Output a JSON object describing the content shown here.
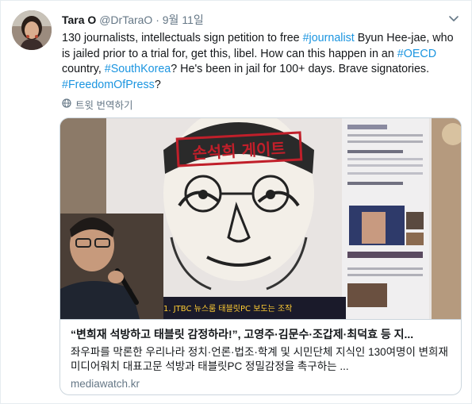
{
  "tweet": {
    "author_name": "Tara O",
    "handle": "@DrTaraO",
    "separator": "·",
    "date": "9월 11일",
    "text_segments": [
      {
        "text": "130 journalists, intellectuals sign petition to free ",
        "type": "text"
      },
      {
        "text": "#journalist",
        "type": "hashtag"
      },
      {
        "text": " Byun Hee-jae, who is jailed prior to a trial for, get this, libel. How can this happen in an ",
        "type": "text"
      },
      {
        "text": "#OECD",
        "type": "hashtag"
      },
      {
        "text": " country, ",
        "type": "text"
      },
      {
        "text": "#SouthKorea",
        "type": "hashtag"
      },
      {
        "text": "? He's been in jail for 100+ days. Brave signatories. ",
        "type": "text"
      },
      {
        "text": "#FreedomOfPress",
        "type": "hashtag"
      },
      {
        "text": "?",
        "type": "text"
      }
    ],
    "translate_label": "트윗 번역하기"
  },
  "card": {
    "image_overlay_text": "손석희 게이트",
    "image_slide_text": "1. JTBC 뉴스룸 태블릿PC 보도는 조작",
    "title": "“변희재 석방하고 태블릿 감정하라!”, 고영주·김문수·조갑제·최덕효 등 지...",
    "description": "좌우파를 막론한 우리나라 정치·언론·법조·학계 및 시민단체 지식인 130여명이 변희재 미디어워치 대표고문 석방과 태블릿PC 정밀감정을 촉구하는 ...",
    "domain": "mediawatch.kr"
  },
  "icons": {
    "chevron": "chevron-down-icon",
    "globe": "globe-icon"
  },
  "colors": {
    "link": "#1b95e0",
    "secondary_text": "#657786",
    "border": "#ccd6dd"
  }
}
